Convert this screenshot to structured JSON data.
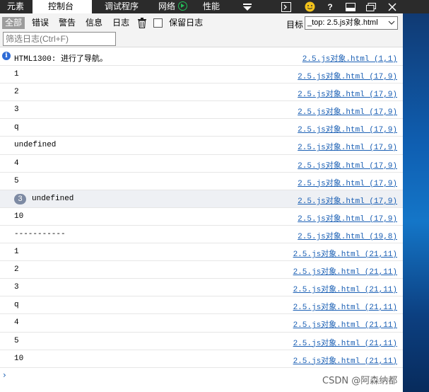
{
  "tabs": [
    {
      "label": "元素"
    },
    {
      "label": "控制台"
    },
    {
      "label": "调试程序"
    },
    {
      "label": "网络"
    },
    {
      "label": "性能"
    }
  ],
  "toolbar": {
    "filters": [
      "全部",
      "错误",
      "警告",
      "信息",
      "日志"
    ],
    "preserve_log_label": "保留日志",
    "target_label": "目标",
    "target_value": "_top: 2.5.js对象.html",
    "filter_placeholder": "筛选日志(Ctrl+F)"
  },
  "console": {
    "rows": [
      {
        "msg": "HTML1300: 进行了导航。",
        "src": "2.5.js对象.html (1,1)",
        "type": "info"
      },
      {
        "msg": "1",
        "src": "2.5.js对象.html (17,9)"
      },
      {
        "msg": "2",
        "src": "2.5.js对象.html (17,9)"
      },
      {
        "msg": "3",
        "src": "2.5.js对象.html (17,9)"
      },
      {
        "msg": "q",
        "src": "2.5.js对象.html (17,9)"
      },
      {
        "msg": "undefined",
        "src": "2.5.js对象.html (17,9)"
      },
      {
        "msg": "4",
        "src": "2.5.js对象.html (17,9)"
      },
      {
        "msg": "5",
        "src": "2.5.js对象.html (17,9)"
      },
      {
        "msg": "undefined",
        "src": "2.5.js对象.html (17,9)",
        "count": "3"
      },
      {
        "msg": "10",
        "src": "2.5.js对象.html (17,9)"
      },
      {
        "msg": "-----------",
        "src": "2.5.js对象.html (19,8)"
      },
      {
        "msg": "1",
        "src": "2.5.js对象.html (21,11)"
      },
      {
        "msg": "2",
        "src": "2.5.js对象.html (21,11)"
      },
      {
        "msg": "3",
        "src": "2.5.js对象.html (21,11)"
      },
      {
        "msg": "q",
        "src": "2.5.js对象.html (21,11)"
      },
      {
        "msg": "4",
        "src": "2.5.js对象.html (21,11)"
      },
      {
        "msg": "5",
        "src": "2.5.js对象.html (21,11)"
      },
      {
        "msg": "10",
        "src": "2.5.js对象.html (21,11)"
      }
    ],
    "prompt": "›"
  },
  "watermark": "CSDN @阿森纳都",
  "colors": {
    "link": "#1a5fb4",
    "tabbar": "#2b2b2b",
    "play": "#23c15a"
  }
}
